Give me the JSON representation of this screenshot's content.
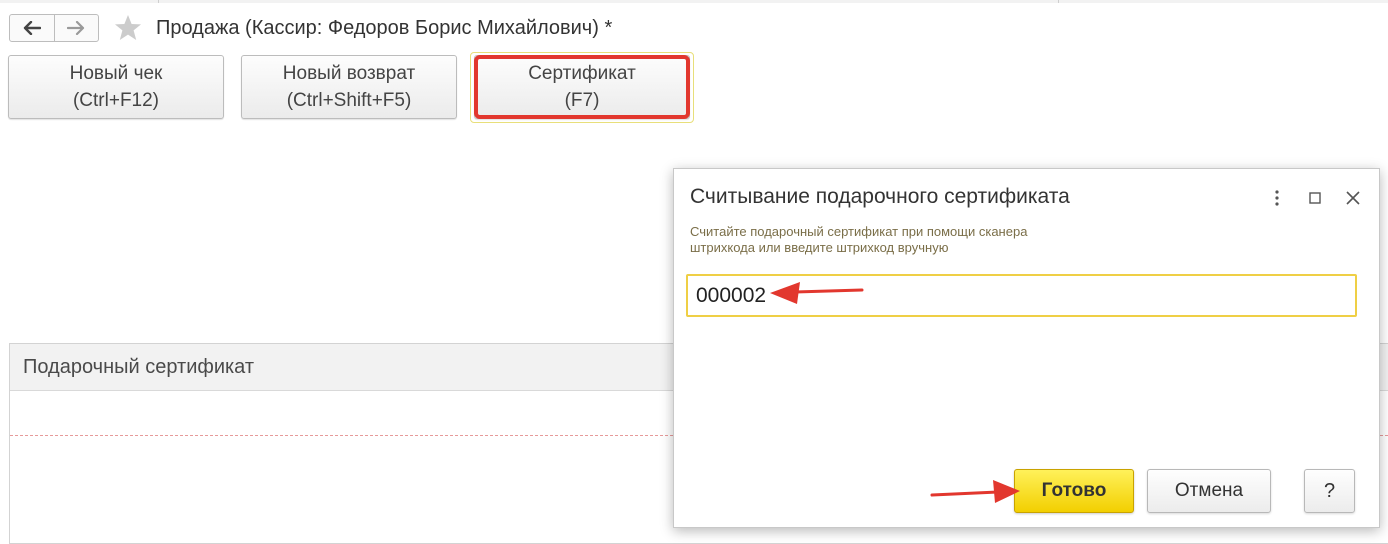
{
  "window": {
    "title": "Продажа (Кассир: Федоров Борис Михайлович) *"
  },
  "toolbar": {
    "buttons": [
      {
        "line1": "Новый чек",
        "line2": "(Ctrl+F12)"
      },
      {
        "line1": "Новый возврат",
        "line2": "(Ctrl+Shift+F5)"
      },
      {
        "line1": "Сертификат",
        "line2": "(F7)"
      }
    ]
  },
  "panel": {
    "header": "Подарочный сертификат"
  },
  "dialog": {
    "title": "Считывание подарочного сертификата",
    "hint_line1": "Считайте подарочный сертификат при помощи сканера",
    "hint_line2": "штрихкода или введите штрихкод вручную",
    "barcode_value": "000002",
    "ok_label": "Готово",
    "cancel_label": "Отмена",
    "help_label": "?"
  },
  "colors": {
    "highlight_red": "#e2372e",
    "accent_yellow": "#f2cf00",
    "input_border": "#efcf45"
  },
  "icons": [
    "back-arrow-icon",
    "forward-arrow-icon",
    "star-icon",
    "more-vertical-icon",
    "maximize-icon",
    "close-icon"
  ]
}
